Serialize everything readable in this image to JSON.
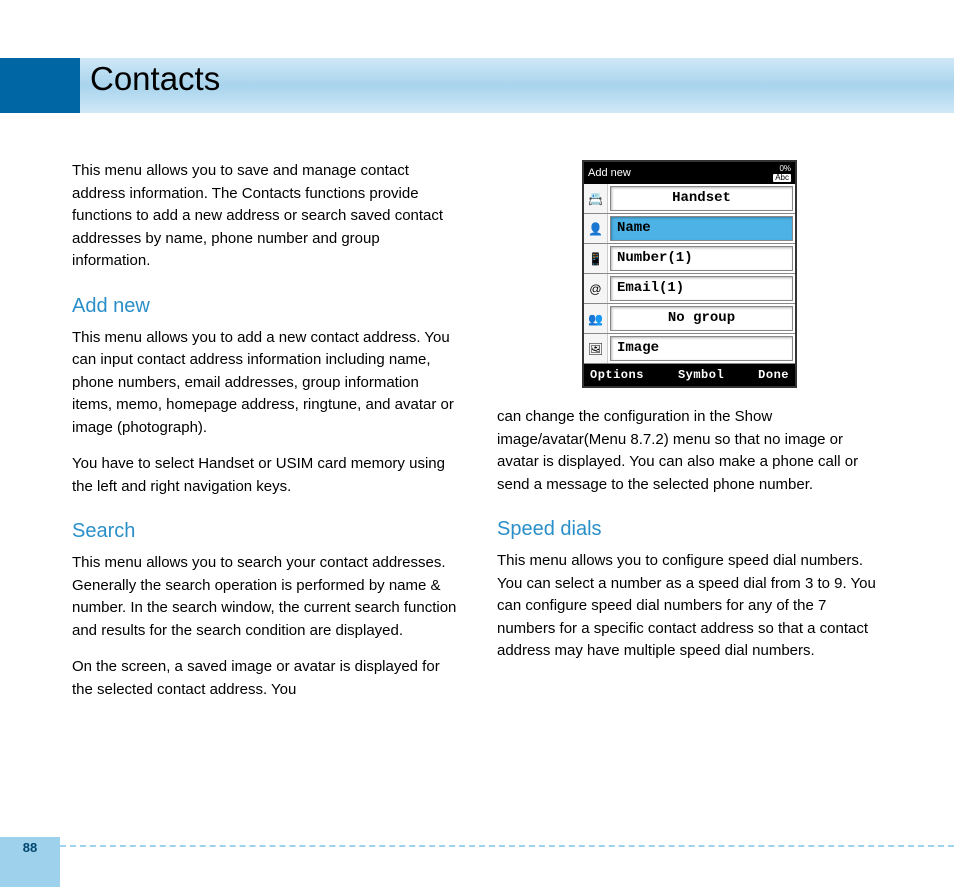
{
  "page": {
    "title": "Contacts",
    "number": "88"
  },
  "left_column": {
    "intro": "This menu allows you to save and manage contact address information. The Contacts functions provide functions to add a new address or search saved contact addresses by name, phone number and group information.",
    "addnew": {
      "heading": "Add new",
      "p1": "This menu allows you to add a new contact address. You can input contact address information including name, phone numbers, email addresses, group information items, memo, homepage address, ringtune, and avatar or image (photograph).",
      "p2": "You have to select Handset or USIM card memory using the left and right navigation keys."
    },
    "search": {
      "heading": "Search",
      "p1": "This menu allows you to search your contact addresses. Generally the search operation is performed by name & number. In the search window, the current search function and results for the search condition are displayed.",
      "p2": "On the screen, a saved image or avatar is displayed for the selected contact address. You"
    }
  },
  "right_column": {
    "continuation": "can change the configuration in the Show image/avatar(Menu 8.7.2) menu so that no image or avatar is displayed. You can also make a phone call or send a message to the selected phone number.",
    "speed": {
      "heading": "Speed dials",
      "p1": "This menu allows you to configure speed dial numbers. You can select a number as a speed dial from 3 to 9. You can configure speed dial numbers for any of the 7 numbers for a specific contact address so that a contact address may have multiple speed dial numbers."
    }
  },
  "phone": {
    "title": "Add new",
    "signal": "0%",
    "mode": "Abc",
    "rows": {
      "handset": "Handset",
      "name": "Name",
      "number": "Number(1)",
      "email": "Email(1)",
      "group": "No group",
      "image": "Image"
    },
    "softkeys": {
      "left": "Options",
      "center": "Symbol",
      "right": "Done"
    }
  }
}
